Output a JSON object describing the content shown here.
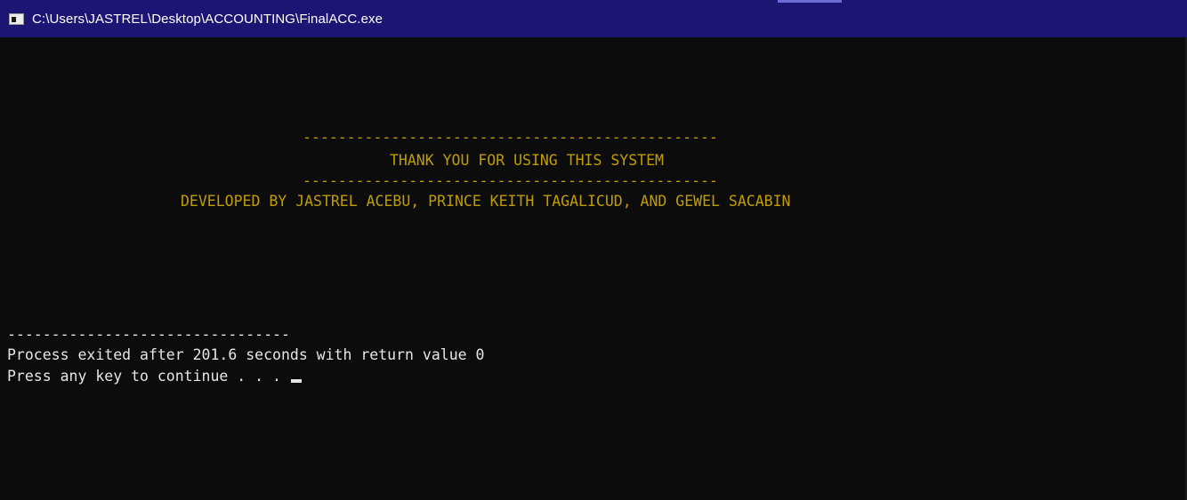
{
  "window": {
    "title": "C:\\Users\\JASTREL\\Desktop\\ACCOUNTING\\FinalACC.exe",
    "app_icon": "console-app-icon"
  },
  "console": {
    "banner_rule_top": "-----------------------------------------------",
    "banner_title": "THANK YOU FOR USING THIS SYSTEM",
    "banner_rule_bottom": "-----------------------------------------------",
    "credits": "DEVELOPED BY JASTREL ACEBU, PRINCE KEITH TAGALICUD, AND GEWEL SACABIN",
    "separator": "--------------------------------",
    "exit_message": "Process exited after 201.6 seconds with return value 0",
    "prompt": "Press any key to continue . . . "
  },
  "colors": {
    "titlebar": "#1d1574",
    "console_background": "#0c0c0c",
    "banner_text": "#c19c00",
    "console_text": "#e6e6e6"
  }
}
